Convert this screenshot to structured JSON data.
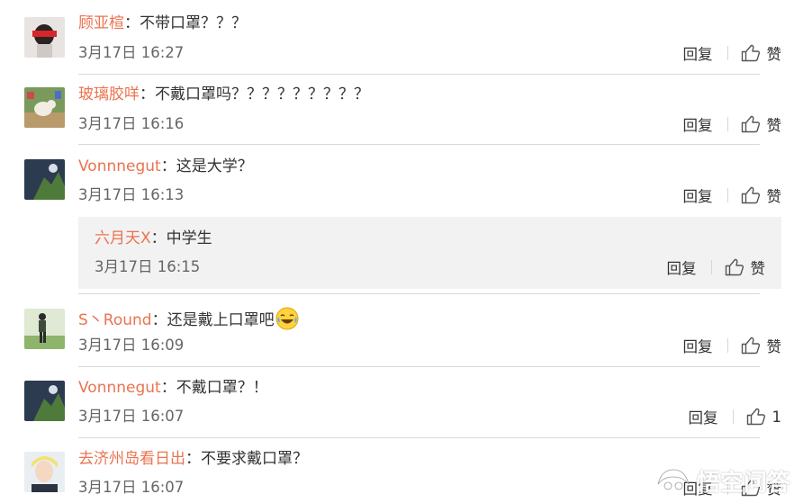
{
  "comments": [
    {
      "username": "顾亚楦",
      "text": "不带口罩？？？",
      "time": "3月17日 16:27",
      "reply_label": "回复",
      "like_label": "赞"
    },
    {
      "username": "玻璃胶咩",
      "text": "不戴口罩吗？？？？？？？？？",
      "time": "3月17日 16:16",
      "reply_label": "回复",
      "like_label": "赞"
    },
    {
      "username": "Vonnnegut",
      "text": "这是大学？",
      "time": "3月17日 16:13",
      "reply_label": "回复",
      "like_label": "赞",
      "reply": {
        "username": "六月天X",
        "text": "中学生",
        "time": "3月17日 16:15",
        "reply_label": "回复",
        "like_label": "赞"
      }
    },
    {
      "username": "S丶Round",
      "text": "还是戴上口罩吧",
      "emoji": "laughing-tears-emoji",
      "time": "3月17日 16:09",
      "reply_label": "回复",
      "like_label": "赞"
    },
    {
      "username": "Vonnnegut",
      "text": "不戴口罩？！",
      "time": "3月17日 16:07",
      "reply_label": "回复",
      "like_label": "1"
    },
    {
      "username": "去济州岛看日出",
      "text": "不要求戴口罩？",
      "time": "3月17日 16:07",
      "reply_label": "回复",
      "like_label": "赞"
    }
  ],
  "separator": "：",
  "colors": {
    "username": "#eb7350",
    "text": "#333333",
    "time": "#666666",
    "divider": "#d9d9d9",
    "reply_bg": "#f2f2f2"
  },
  "icons": {
    "like": "thumbs-up-icon"
  },
  "watermark": {
    "text": "悟空问答",
    "logo": "wukong-logo"
  }
}
